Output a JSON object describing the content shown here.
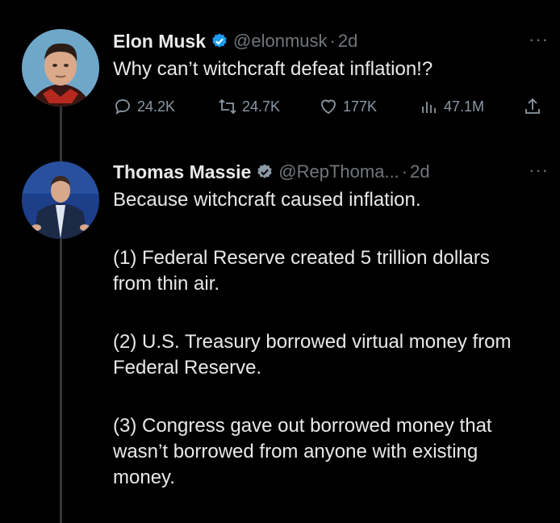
{
  "tweets": [
    {
      "name": "Elon Musk",
      "handle": "@elonmusk",
      "separator": "·",
      "time": "2d",
      "more": "···",
      "text": "Why can’t witchcraft defeat inflation!?",
      "actions": {
        "replies": "24.2K",
        "retweets": "24.7K",
        "likes": "177K",
        "views": "47.1M"
      }
    },
    {
      "name": "Thomas Massie",
      "handle": "@RepThoma...",
      "separator": "·",
      "time": "2d",
      "more": "···",
      "paragraphs": [
        "Because witchcraft caused inflation.",
        "(1) Federal Reserve created 5 trillion dollars from thin air.",
        "(2) U.S. Treasury borrowed virtual money from Federal Reserve.",
        "(3) Congress gave out borrowed money that wasn’t borrowed from anyone with existing money."
      ]
    }
  ],
  "colors": {
    "background": "#000000",
    "text": "#e7e9ea",
    "secondary": "#71767b",
    "verified": "#1d9bf0",
    "thread_line": "#333639"
  },
  "icons": [
    "verified-badge-icon",
    "reply-icon",
    "retweet-icon",
    "like-icon",
    "views-icon",
    "share-icon",
    "more-icon"
  ]
}
